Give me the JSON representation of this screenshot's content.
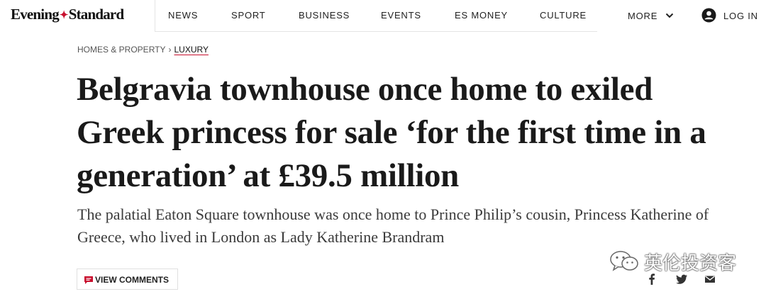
{
  "header": {
    "logo_part1": "Evening",
    "logo_part2": "Standard",
    "nav": [
      "NEWS",
      "SPORT",
      "BUSINESS",
      "EVENTS",
      "ES MONEY",
      "CULTURE"
    ],
    "more_label": "MORE",
    "login_label": "LOG IN"
  },
  "breadcrumb": {
    "parent": "HOMES & PROPERTY",
    "separator": "›",
    "current": "LUXURY"
  },
  "article": {
    "headline": "Belgravia townhouse once home to exiled Greek princess for sale ‘for the first time in a generation’ at £39.5 million",
    "standfirst": "The palatial Eaton Square townhouse was once home to Prince Philip’s cousin, Princess Katherine of Greece, who lived in London as Lady Katherine Brandram"
  },
  "comments_button": {
    "label": "VIEW COMMENTS"
  },
  "share": [
    {
      "name": "facebook-icon",
      "glyph": "f"
    },
    {
      "name": "twitter-icon",
      "glyph": ""
    },
    {
      "name": "email-icon",
      "glyph": ""
    }
  ],
  "watermark": {
    "text": "英伦投资客"
  },
  "colors": {
    "accent": "#c8102e",
    "text": "#1a1a1a",
    "muted": "#555555"
  }
}
